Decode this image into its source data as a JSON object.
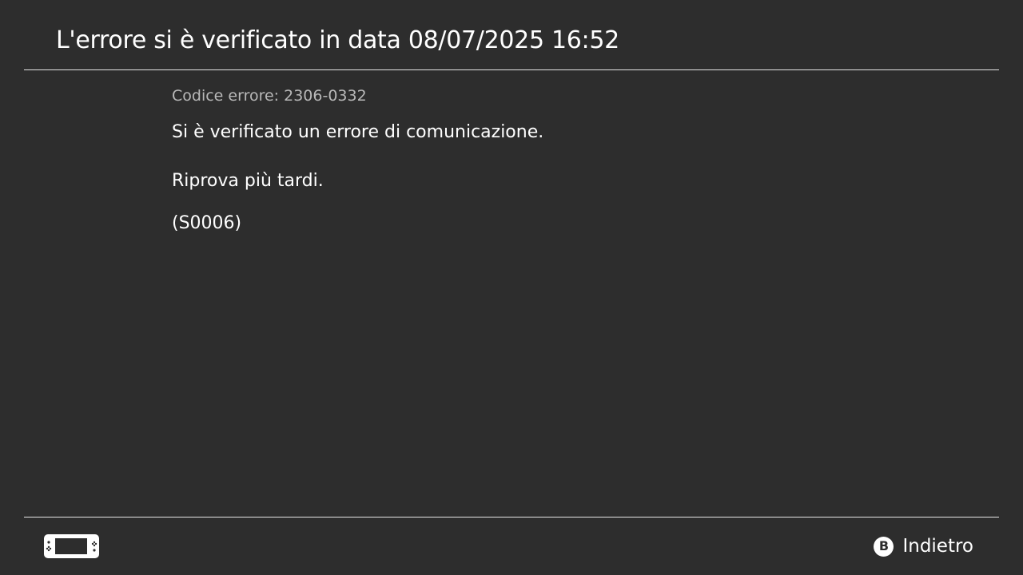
{
  "header": {
    "title": "L'errore si è verificato in data 08/07/2025 16:52"
  },
  "error": {
    "code_text": "Codice errore: 2306-0332",
    "message_line1": "Si è verificato un errore di comunicazione.",
    "message_line2": "Riprova più tardi.",
    "message_line3": "(S0006)"
  },
  "footer": {
    "console_icon": "handheld-console-icon",
    "back_button_icon": "b-button-icon",
    "back_button_glyph": "B",
    "back_label": "Indietro"
  },
  "colors": {
    "background": "#2d2d2d",
    "text": "#ffffff",
    "secondary_text": "#b9b9b9",
    "divider": "#e6e6e6"
  }
}
